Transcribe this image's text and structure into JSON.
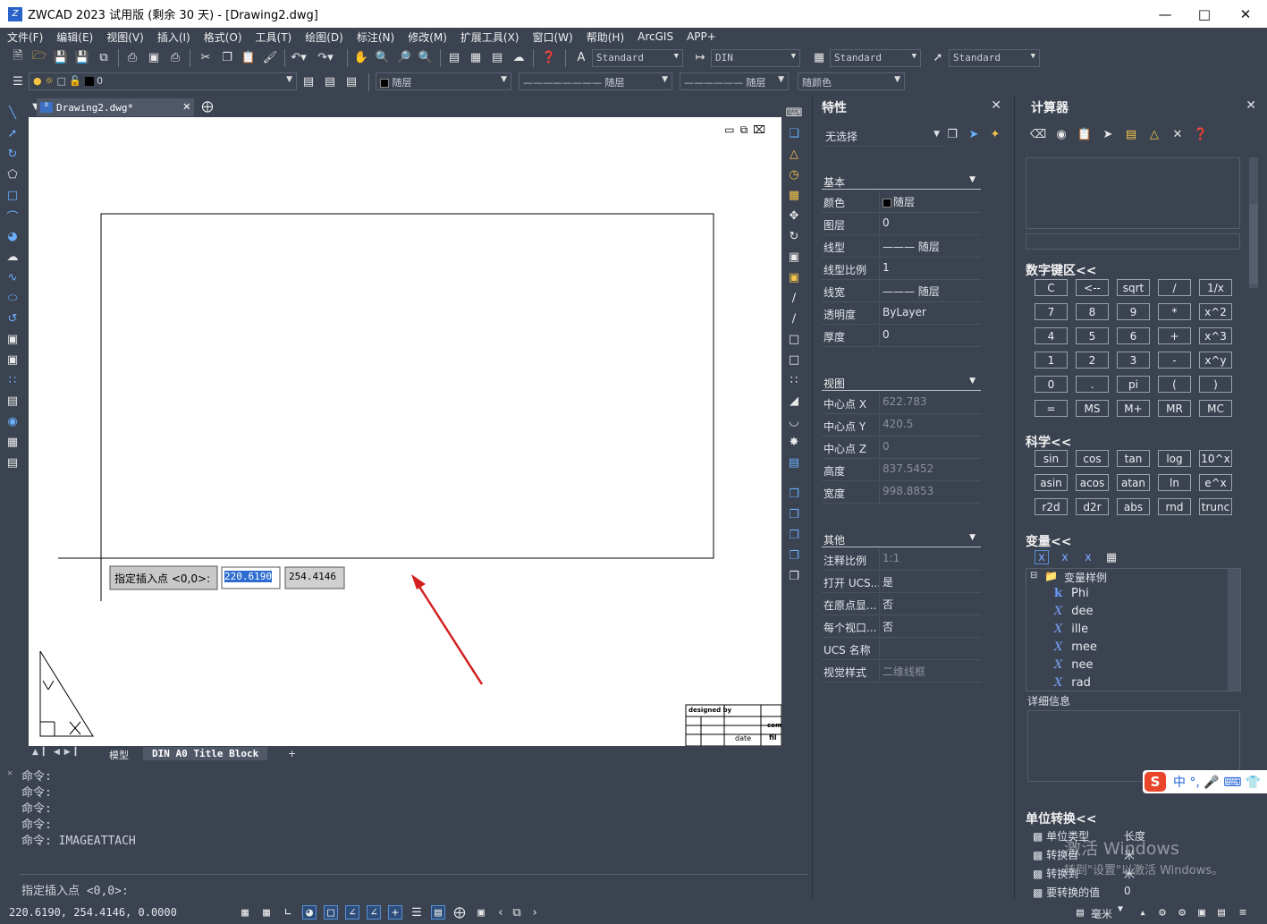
{
  "app": {
    "title": "ZWCAD 2023 试用版 (剩余 30 天) - [Drawing2.dwg]",
    "logo": "Z"
  },
  "menu": [
    "文件(F)",
    "编辑(E)",
    "视图(V)",
    "插入(I)",
    "格式(O)",
    "工具(T)",
    "绘图(D)",
    "标注(N)",
    "修改(M)",
    "扩展工具(X)",
    "窗口(W)",
    "帮助(H)",
    "ArcGIS",
    "APP+"
  ],
  "toolbar": {
    "text_style": "Standard",
    "dim_style": "DIN",
    "table_style": "Standard",
    "mleader_style": "Standard",
    "layer": "0",
    "color": "随层",
    "linetype": "随层",
    "lineweight": "随层",
    "plot_style": "随颜色"
  },
  "document": {
    "tab": "Drawing2.dwg*",
    "prompt": "指定插入点 <0,0>:",
    "input_x": "220.6190",
    "input_y": "254.4146"
  },
  "titleblock": {
    "designed_by": "designed by",
    "date": "date",
    "c1": "comp",
    "c2": "fil"
  },
  "layouts": {
    "model": "模型",
    "layout1": "DIN A0 Title Block",
    "add": "+"
  },
  "command": {
    "history": [
      "命令:",
      "命令:",
      "命令:",
      "命令:",
      "命令: IMAGEATTACH"
    ],
    "current": "指定插入点 <0,0>:"
  },
  "status": {
    "coords": "220.6190, 254.4146, 0.0000",
    "unit": "毫米"
  },
  "properties": {
    "title": "特性",
    "selection": "无选择",
    "basic": {
      "title": "基本",
      "rows": [
        {
          "k": "颜色",
          "v": "随层"
        },
        {
          "k": "图层",
          "v": "0"
        },
        {
          "k": "线型",
          "v": "——— 随层"
        },
        {
          "k": "线型比例",
          "v": "1"
        },
        {
          "k": "线宽",
          "v": "——— 随层"
        },
        {
          "k": "透明度",
          "v": "ByLayer"
        },
        {
          "k": "厚度",
          "v": "0"
        }
      ]
    },
    "view": {
      "title": "视图",
      "rows": [
        {
          "k": "中心点 X",
          "v": "622.783"
        },
        {
          "k": "中心点 Y",
          "v": "420.5"
        },
        {
          "k": "中心点 Z",
          "v": "0"
        },
        {
          "k": "高度",
          "v": "837.5452"
        },
        {
          "k": "宽度",
          "v": "998.8853"
        }
      ]
    },
    "misc": {
      "title": "其他",
      "rows": [
        {
          "k": "注释比例",
          "v": "1:1"
        },
        {
          "k": "打开 UCS...",
          "v": "是"
        },
        {
          "k": "在原点显...",
          "v": "否"
        },
        {
          "k": "每个视口...",
          "v": "否"
        },
        {
          "k": "UCS 名称",
          "v": ""
        },
        {
          "k": "视觉样式",
          "v": "二维线框"
        }
      ]
    }
  },
  "calculator": {
    "title": "计算器",
    "keypad_title": "数字键区<<",
    "keypad": [
      "C",
      "<--",
      "sqrt",
      "/",
      "1/x",
      "7",
      "8",
      "9",
      "*",
      "x^2",
      "4",
      "5",
      "6",
      "+",
      "x^3",
      "1",
      "2",
      "3",
      "-",
      "x^y",
      "0",
      ".",
      "pi",
      "(",
      ")",
      "=",
      "MS",
      "M+",
      "MR",
      "MC"
    ],
    "sci_title": "科学<<",
    "sci": [
      "sin",
      "cos",
      "tan",
      "log",
      "10^x",
      "asin",
      "acos",
      "atan",
      "ln",
      "e^x",
      "r2d",
      "d2r",
      "abs",
      "rnd",
      "trunc"
    ],
    "vars_title": "变量<<",
    "var_folder": "变量样例",
    "vars": [
      "Phi",
      "dee",
      "ille",
      "mee",
      "nee",
      "rad"
    ],
    "details_title": "详细信息",
    "unit_title": "单位转换<<",
    "units": [
      {
        "k": "单位类型",
        "v": "长度"
      },
      {
        "k": "转换自",
        "v": "米"
      },
      {
        "k": "转换到",
        "v": "米"
      },
      {
        "k": "要转换的值",
        "v": "0"
      }
    ]
  },
  "ime": {
    "logo": "S",
    "label": "中 °, 🎤 ⌨ 👕"
  },
  "watermark": {
    "line1": "激活 Windows",
    "line2": "转到\"设置\"以激活 Windows。"
  }
}
